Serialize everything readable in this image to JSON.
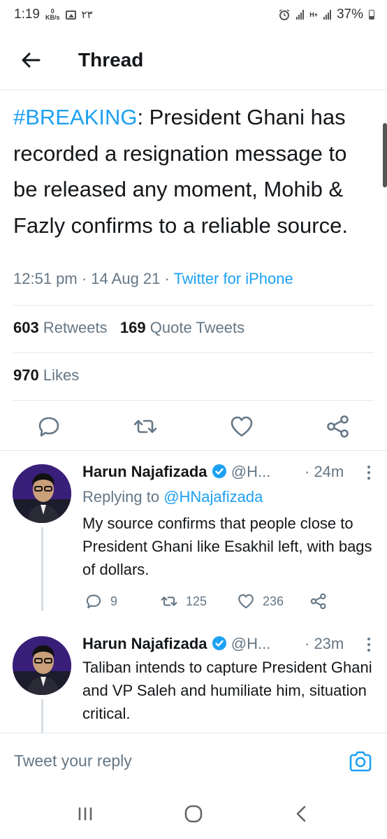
{
  "status_bar": {
    "time": "1:19",
    "net_speed_value": "0",
    "net_speed_unit": "KB/s",
    "extra_text": "۲۳",
    "network_type": "H+",
    "battery": "37%"
  },
  "header": {
    "title": "Thread"
  },
  "tweet": {
    "hashtag": "#BREAKING",
    "text_rest": ": President Ghani has recorded a resignation message to be released any moment, Mohib & Fazly confirms to a reliable source.",
    "time": "12:51 pm",
    "date": "14 Aug 21",
    "source": "Twitter for iPhone",
    "retweets_count": "603",
    "retweets_label": "Retweets",
    "quotes_count": "169",
    "quotes_label": "Quote Tweets",
    "likes_count": "970",
    "likes_label": "Likes"
  },
  "replies": [
    {
      "name": "Harun Najafizada",
      "handle": "@H...",
      "time": "· 24m",
      "replying_label": "Replying to",
      "replying_to": "@HNajafizada",
      "text": "My source confirms that people close to President Ghani like Esakhil left, with bags of dollars.",
      "reply_count": "9",
      "retweet_count": "125",
      "like_count": "236"
    },
    {
      "name": "Harun Najafizada",
      "handle": "@H...",
      "time": "· 23m",
      "text": "Taliban intends to capture President Ghani and VP Saleh and humiliate him, situation critical."
    }
  ],
  "reply_bar": {
    "placeholder": "Tweet your reply"
  },
  "colors": {
    "accent": "#1da1f2",
    "muted": "#657786",
    "text": "#14171a",
    "divider": "#e1e8ed"
  },
  "icons": [
    "back-arrow-icon",
    "reply-icon",
    "retweet-icon",
    "like-icon",
    "share-icon",
    "verified-icon",
    "more-icon",
    "camera-icon",
    "recent-apps-icon",
    "home-icon",
    "back-nav-icon"
  ]
}
